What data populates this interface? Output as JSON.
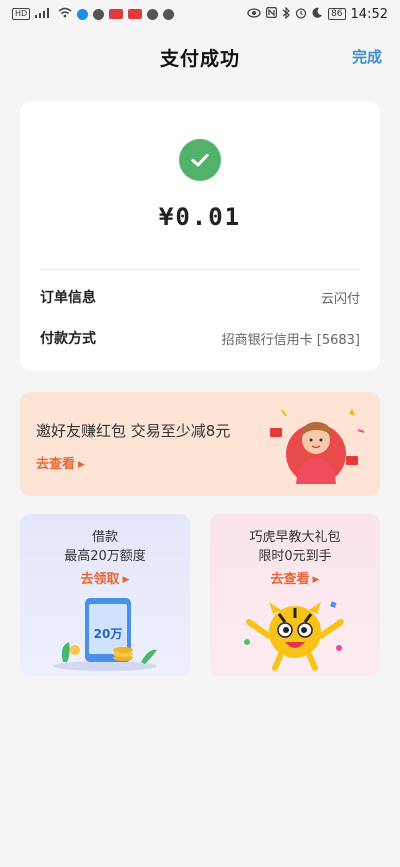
{
  "status_bar": {
    "hd": "HD",
    "signal": "⁴⁶",
    "battery": "86",
    "time": "14:52"
  },
  "header": {
    "title": "支付成功",
    "done_label": "完成"
  },
  "result": {
    "amount": "¥0.01",
    "rows": [
      {
        "key": "订单信息",
        "value": "云闪付"
      },
      {
        "key": "付款方式",
        "value": "招商银行信用卡 [5683]"
      }
    ]
  },
  "invite_banner": {
    "title": "邀好友赚红包 交易至少减8元",
    "link": "去查看"
  },
  "promos": [
    {
      "line1": "借款",
      "line2": "最高20万额度",
      "link": "去领取",
      "badge": "20万"
    },
    {
      "line1": "巧虎早教大礼包",
      "line2": "限时0元到手",
      "link": "去查看"
    }
  ],
  "colors": {
    "accent": "#3d8fd0",
    "success": "#53b26a",
    "link": "#e4683a",
    "invite_bg": "#fde4d5",
    "loan_bg": "#e4e7fb",
    "gift_bg": "#fbe4ec"
  },
  "icons": [
    "wifi-icon",
    "eye-icon",
    "nfc-icon",
    "bluetooth-icon",
    "alarm-icon",
    "moon-icon",
    "check-icon",
    "arrow-right-icon"
  ]
}
